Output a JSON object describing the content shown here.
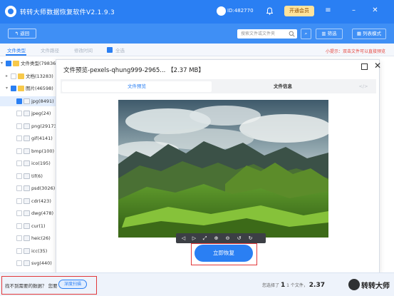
{
  "app": {
    "title": "转转大师数据恢复软件V2.1.9.3",
    "user_id": "ID:482770",
    "vip_label": "开通会员"
  },
  "toolbar": {
    "back_label": "返回",
    "search_placeholder": "搜索文件或文件夹",
    "filter_label": "筛选",
    "view_label": "列表模式"
  },
  "tabs": {
    "items": [
      "文件类型",
      "文件路径",
      "修改时间",
      "全选"
    ],
    "tip": "小提示：双击文件可以直接预览"
  },
  "tree": [
    {
      "label": "文件类型(79836)",
      "checked": true,
      "arrow": "▾",
      "icon": "folder",
      "level": 0
    },
    {
      "label": "文档(13283)",
      "checked": false,
      "arrow": "▸",
      "icon": "folder",
      "level": 1
    },
    {
      "label": "图片(46598)",
      "checked": true,
      "arrow": "▾",
      "icon": "folder",
      "level": 1
    },
    {
      "label": "jpg(8491)",
      "checked": true,
      "arrow": "",
      "icon": "file",
      "level": 2,
      "selected": true
    },
    {
      "label": "jpeg(24)",
      "checked": false,
      "arrow": "",
      "icon": "file",
      "level": 2
    },
    {
      "label": "png(29173)",
      "checked": false,
      "arrow": "",
      "icon": "file",
      "level": 2
    },
    {
      "label": "gif(4141)",
      "checked": false,
      "arrow": "",
      "icon": "file",
      "level": 2
    },
    {
      "label": "bmp(100)",
      "checked": false,
      "arrow": "",
      "icon": "file",
      "level": 2
    },
    {
      "label": "ico(195)",
      "checked": false,
      "arrow": "",
      "icon": "file",
      "level": 2
    },
    {
      "label": "tif(6)",
      "checked": false,
      "arrow": "",
      "icon": "file",
      "level": 2
    },
    {
      "label": "psd(3026)",
      "checked": false,
      "arrow": "",
      "icon": "file",
      "level": 2
    },
    {
      "label": "cdr(423)",
      "checked": false,
      "arrow": "",
      "icon": "file",
      "level": 2
    },
    {
      "label": "dwg(478)",
      "checked": false,
      "arrow": "",
      "icon": "file",
      "level": 2
    },
    {
      "label": "cur(1)",
      "checked": false,
      "arrow": "",
      "icon": "file",
      "level": 2
    },
    {
      "label": "heic(26)",
      "checked": false,
      "arrow": "",
      "icon": "file",
      "level": 2
    },
    {
      "label": "icc(35)",
      "checked": false,
      "arrow": "",
      "icon": "file",
      "level": 2
    },
    {
      "label": "svg(440)",
      "checked": false,
      "arrow": "",
      "icon": "file",
      "level": 2
    }
  ],
  "modal": {
    "title": "文件预览-pexels-qhung999-2965... 【2.37 MB】",
    "tab_preview": "文件预览",
    "tab_info": "文件信息",
    "tab_code": "</>",
    "recover_label": "立即恢复"
  },
  "bottom": {
    "not_found_text": "找不到需要的数据？ 您要",
    "deep_scan_label": "深度扫描",
    "selected_prefix": "您选择了",
    "selected_count": "1",
    "selected_suffix": "1 个文件，",
    "selected_size": "2.37",
    "watermark": "转转大师"
  },
  "colors": {
    "primary": "#2a7ff3",
    "highlight": "#e2383a",
    "vip": "#ffe39b"
  }
}
